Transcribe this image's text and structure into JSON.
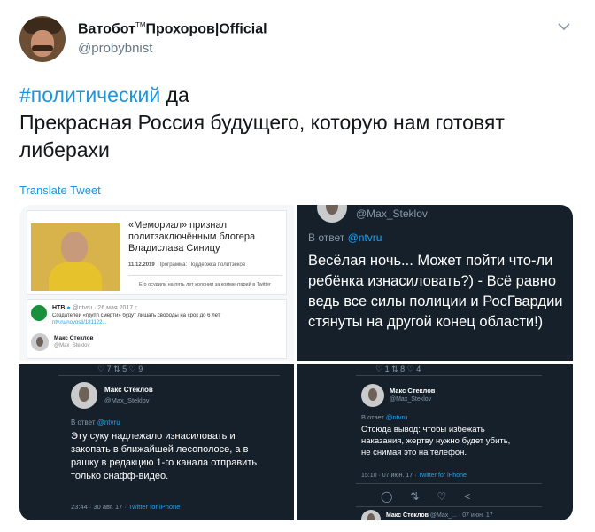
{
  "user": {
    "display_name": "Ватобот",
    "trademark": "TM",
    "display_name_rest": "Прохоров|Official",
    "handle": "@probybnist"
  },
  "tweet": {
    "hashtag": "#политический",
    "after_hashtag": " да",
    "text": "Прекрасная Россия будущего, которую нам готовят либерахи",
    "translate": "Translate Tweet"
  },
  "images": {
    "p1": {
      "headline": "«Мемориал» признал политзаключённым блогера Владислава Синицу",
      "date": "11.12.2019",
      "program": "Программа: Поддержка политзеков",
      "caption": "Его осудили на пять лет колонии за комментарий в Twitter",
      "ntv_name": "НТВ",
      "ntv_meta": "@ntvru · 26 мая 2017 г.",
      "ntv_text": "Создателей «групп смерти» будут лишать свободы на срок до 6 лет",
      "ntv_link": "ntv.ru/novosti/181122...",
      "user_name": "Макс Стеклов",
      "user_handle": "@Max_Steklov"
    },
    "p2": {
      "handle": "@Max_Steklov",
      "reply_prefix": "В ответ ",
      "reply_to": "@ntvru",
      "text": "Весёлая ночь... Может пойти что-ли ребёнка изнасиловать?) - Всё равно ведь все силы полиции и РосГвардии стянуты на другой конец области!)"
    },
    "p3": {
      "actions_top": "♡ 7    ⇅ 5    ♡ 9",
      "user_name": "Макс Стеклов",
      "user_handle": "@Max_Steklov",
      "reply_prefix": "В ответ ",
      "reply_to": "@ntvru",
      "text": "Эту суку надлежало изнасиловать и закопать в ближайшей лесополосе, а в рашку в редакцию 1-го канала отправить только снафф-видео.",
      "meta": "23:44 · 30 авг. 17 · ",
      "client": "Twitter for iPhone"
    },
    "p4": {
      "actions_top": "♡ 1    ⇅ 8    ♡ 4",
      "user_name": "Макс Стеклов",
      "user_handle": "@Max_Steklov",
      "reply_prefix": "В ответ ",
      "reply_to": "@ntvru",
      "text": "Отсюда вывод: чтобы избежать наказания, жертву нужно будет убить, не снимая это на телефон.",
      "meta": "15:10 · 07 июн. 17 · ",
      "client": "Twitter for iPhone",
      "bottom_name": "Макс Стеклов",
      "bottom_meta": "@Max_... · 07 июн. 17"
    }
  },
  "icons": {
    "chevron": "chevron-down-icon"
  },
  "colors": {
    "link": "#1b95e0",
    "dark_bg": "#15202b"
  }
}
